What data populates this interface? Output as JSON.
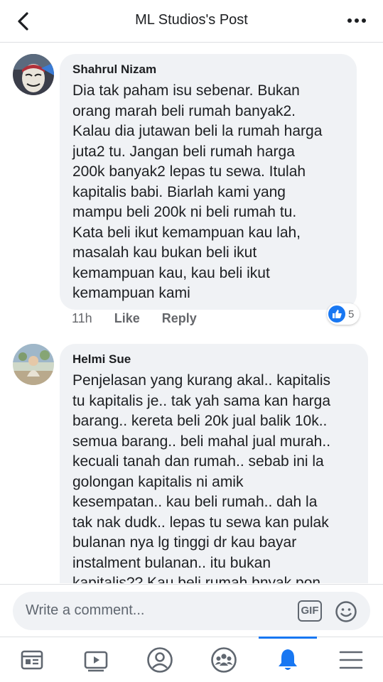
{
  "header": {
    "title": "ML Studios's Post",
    "back_icon": "chevron-left-icon",
    "more_icon": "more-dots-icon"
  },
  "comments": [
    {
      "author": "Shahrul Nizam",
      "text": "Dia tak paham isu sebenar. Bukan\norang marah beli rumah banyak2.\nKalau dia jutawan beli la rumah harga\njuta2 tu. Jangan beli rumah harga\n200k banyak2 lepas tu sewa. Itulah\nkapitalis babi. Biarlah kami yang\nmampu beli 200k ni beli rumah tu.\nKata beli ikut kemampuan kau lah,\nmasalah kau bukan beli ikut\nkemampuan kau, kau beli ikut\nkemampuan kami",
      "time": "11h",
      "like_label": "Like",
      "reply_label": "Reply",
      "reaction_count": "5"
    },
    {
      "author": "Helmi Sue",
      "text": "Penjelasan yang kurang akal.. kapitalis\ntu kapitalis je.. tak yah sama kan harga\nbarang.. kereta beli 20k jual balik 10k..\nsemua barang.. beli mahal jual murah..\nkecuali tanah dan rumah.. sebab ini la\ngolongan kapitalis ni amik\nkesempatan.. kau beli rumah.. dah la\ntak nak dudk.. lepas tu sewa kan pulak\nbulanan nya lg tinggi dr kau bayar\ninstalment bulanan.. itu bukan\nkapitalis?? Kau beli rumah bnyak pon"
    }
  ],
  "composer": {
    "placeholder": "Write a comment...",
    "gif_label": "GIF",
    "emoji_icon": "smiley-icon"
  },
  "tabbar": {
    "active": "notifications",
    "tabs": [
      "news-feed-icon",
      "watch-video-icon",
      "profile-icon",
      "groups-icon",
      "notifications-bell-icon",
      "menu-icon"
    ]
  },
  "colors": {
    "accent": "#1877f2",
    "bubble": "#f0f2f5",
    "text": "#1c1e21",
    "meta": "#65676b"
  }
}
